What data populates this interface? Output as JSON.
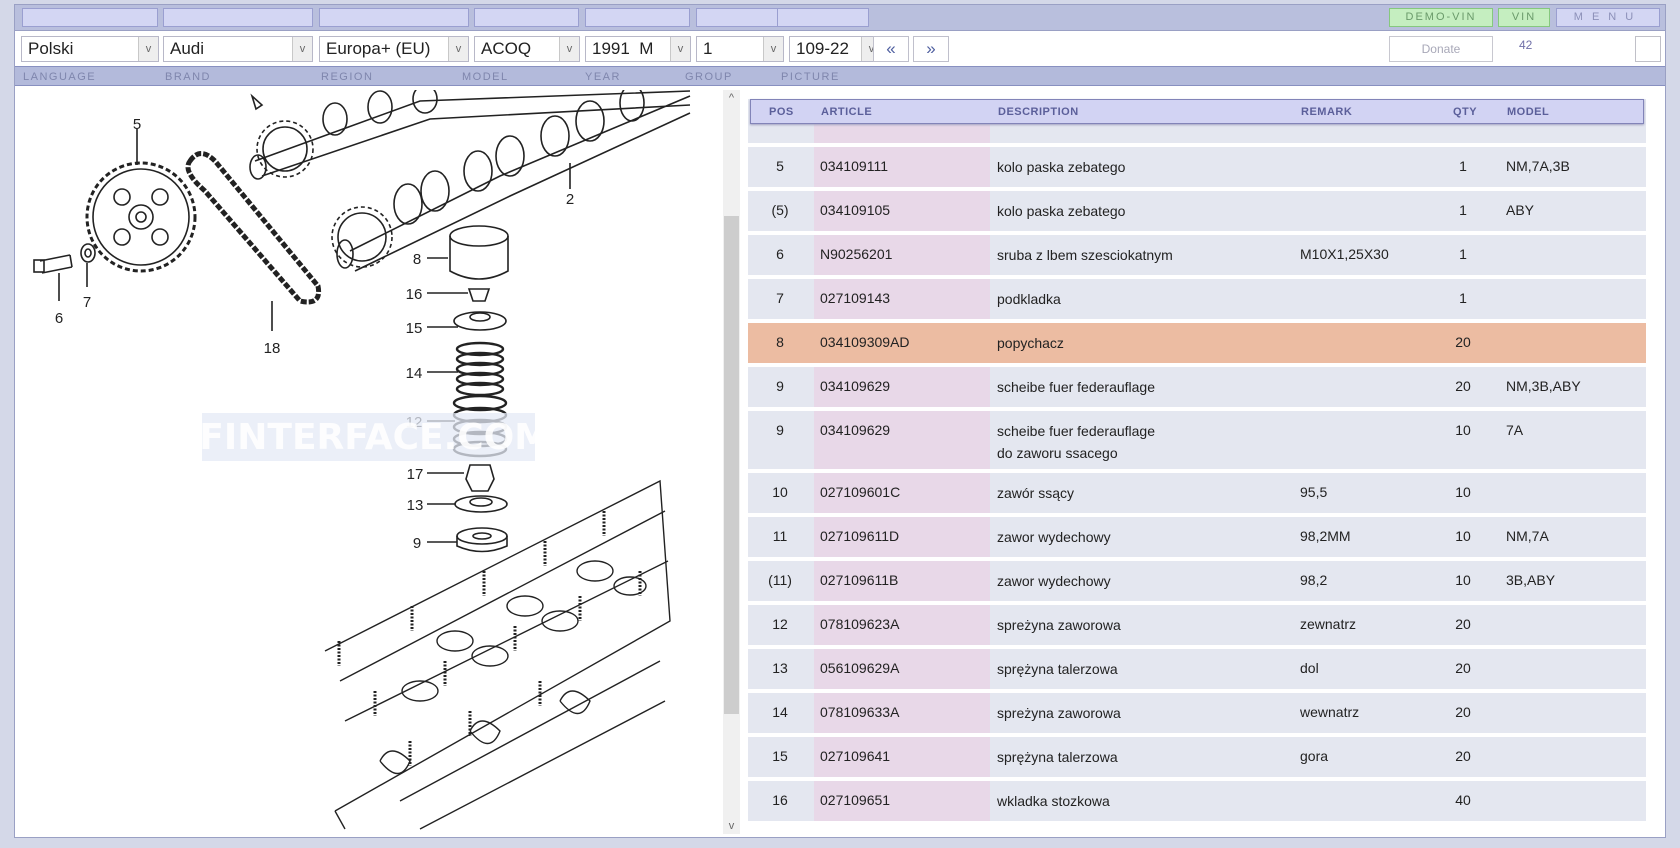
{
  "topbar": {
    "demo_vin": "DEMO-VIN",
    "vin": "VIN",
    "menu": "MENU"
  },
  "selectors": {
    "language": "Polski",
    "brand": "Audi",
    "region": "Europa+ (EU)",
    "model": "ACOQ",
    "year": "1991  M",
    "group": "1",
    "picture": "109-22"
  },
  "nav": {
    "prev": "«",
    "next": "»"
  },
  "donate": "Donate",
  "count": "42",
  "labels": {
    "language": "LANGUAGE",
    "brand": "BRAND",
    "region": "REGION",
    "model": "MODEL",
    "year": "YEAR",
    "group": "GROUP",
    "picture": "PICTURE"
  },
  "drawing": {
    "watermark": "IFINTERFACE.COM",
    "callouts": [
      "5",
      "2",
      "6",
      "7",
      "18",
      "8",
      "16",
      "15",
      "14",
      "12",
      "17",
      "13",
      "9"
    ]
  },
  "table": {
    "headers": {
      "pos": "POS",
      "article": "ARTICLE",
      "description": "DESCRIPTION",
      "remark": "REMARK",
      "qty": "QTY",
      "model": "MODEL"
    },
    "rows": [
      {
        "pos": "5",
        "article": "034109111",
        "description": "kolo paska zebatego",
        "description2": "",
        "remark": "",
        "qty": "1",
        "model": "NM,7A,3B"
      },
      {
        "pos": "(5)",
        "article": "034109105",
        "description": "kolo paska zebatego",
        "description2": "",
        "remark": "",
        "qty": "1",
        "model": "ABY"
      },
      {
        "pos": "6",
        "article": "N90256201",
        "description": "sruba  z lbem szesciokatnym",
        "description2": "",
        "remark": "M10X1,25X30",
        "qty": "1",
        "model": ""
      },
      {
        "pos": "7",
        "article": "027109143",
        "description": "podkladka",
        "description2": "",
        "remark": "",
        "qty": "1",
        "model": ""
      },
      {
        "pos": "8",
        "article": "034109309AD",
        "description": "popychacz",
        "description2": "",
        "remark": "",
        "qty": "20",
        "model": "",
        "selected": true
      },
      {
        "pos": "9",
        "article": "034109629",
        "description": "scheibe fuer federauflage",
        "description2": "",
        "remark": "",
        "qty": "20",
        "model": "NM,3B,ABY"
      },
      {
        "pos": "9",
        "article": "034109629",
        "description": "scheibe fuer federauflage",
        "description2": "do zaworu ssacego",
        "remark": "",
        "qty": "10",
        "model": "7A"
      },
      {
        "pos": "10",
        "article": "027109601C",
        "description": "zawór ssący",
        "description2": "",
        "remark": "95,5",
        "qty": "10",
        "model": ""
      },
      {
        "pos": "11",
        "article": "027109611D",
        "description": "zawor wydechowy",
        "description2": "",
        "remark": "98,2MM",
        "qty": "10",
        "model": "NM,7A"
      },
      {
        "pos": "(11)",
        "article": "027109611B",
        "description": "zawor wydechowy",
        "description2": "",
        "remark": "98,2",
        "qty": "10",
        "model": "3B,ABY"
      },
      {
        "pos": "12",
        "article": "078109623A",
        "description": "spreżyna zaworowa",
        "description2": "",
        "remark": "zewnatrz",
        "qty": "20",
        "model": ""
      },
      {
        "pos": "13",
        "article": "056109629A",
        "description": "sprężyna talerzowa",
        "description2": "",
        "remark": "dol",
        "qty": "20",
        "model": ""
      },
      {
        "pos": "14",
        "article": "078109633A",
        "description": "spreżyna zaworowa",
        "description2": "",
        "remark": "wewnatrz",
        "qty": "20",
        "model": ""
      },
      {
        "pos": "15",
        "article": "027109641",
        "description": "sprężyna talerzowa",
        "description2": "",
        "remark": "gora",
        "qty": "20",
        "model": ""
      },
      {
        "pos": "16",
        "article": "027109651",
        "description": "wkladka stozkowa",
        "description2": "",
        "remark": "",
        "qty": "40",
        "model": ""
      }
    ]
  },
  "colors": {
    "selected_row": "#ecbca2",
    "row": "#e4e7f0",
    "article_column": "#e8d8e8",
    "header": "#d2d3f3",
    "vin_button": "#c5eec0"
  }
}
